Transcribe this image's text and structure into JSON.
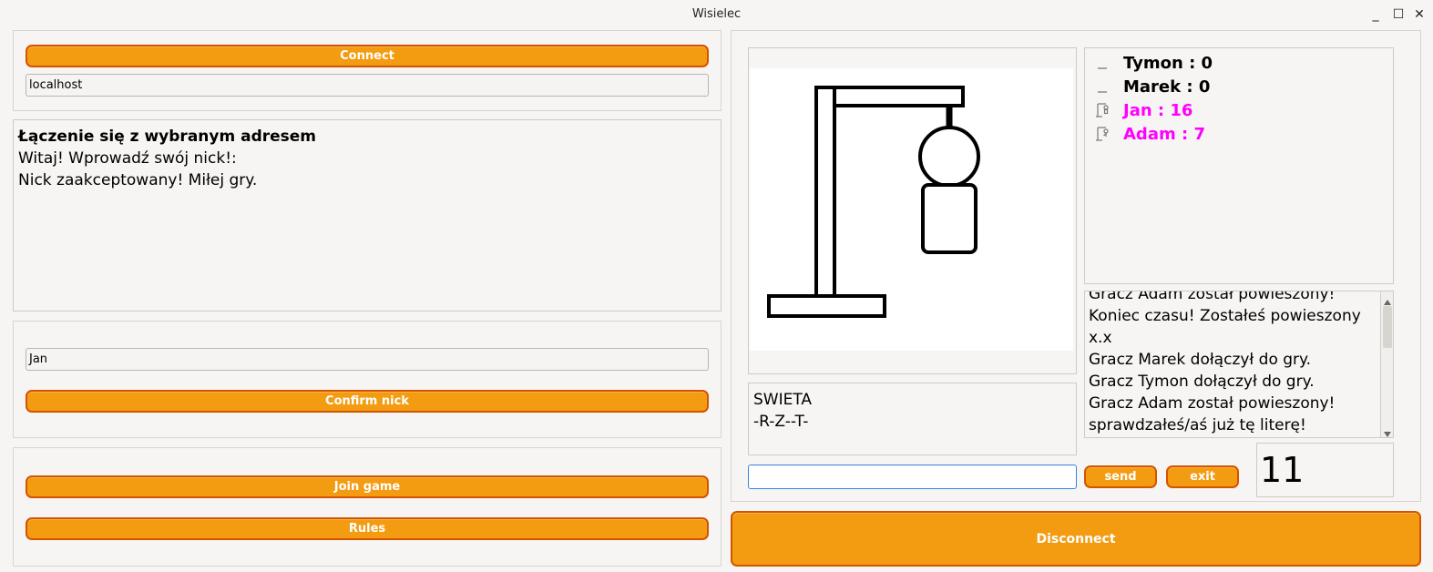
{
  "window": {
    "title": "Wisielec"
  },
  "window_controls": {
    "minimize": "_",
    "maximize": "☐",
    "close": "✕"
  },
  "connection": {
    "connect_label": "Connect",
    "host_value": "localhost"
  },
  "status_log": {
    "lines": [
      "Łączenie się z wybranym adresem",
      "Witaj! Wprowadź swój nick!:",
      "Nick zaakceptowany! Miłej gry."
    ]
  },
  "nick": {
    "value": "Jan",
    "confirm_label": "Confirm nick"
  },
  "game_buttons": {
    "join_label": "Join game",
    "rules_label": "Rules"
  },
  "disconnect_label": "Disconnect",
  "word": {
    "category": "SWIETA",
    "pattern": "-R-Z--T-"
  },
  "scores": [
    {
      "text": "Tymon : 0",
      "color": "#000000",
      "icon": "empty-gallows-icon"
    },
    {
      "text": "Marek : 0",
      "color": "#000000",
      "icon": "empty-gallows-icon"
    },
    {
      "text": "Jan : 16",
      "color": "#ff00ff",
      "icon": "gallows-icon"
    },
    {
      "text": "Adam : 7",
      "color": "#ff00ff",
      "icon": "gallows-icon"
    }
  ],
  "chat": {
    "lines": [
      "Gracz Adam został powieszony!",
      "Koniec czasu! Zostałeś powieszony",
      "x.x",
      "Gracz Marek dołączył do gry.",
      "Gracz Tymon dołączył do gry.",
      "Gracz Adam został powieszony!",
      "sprawdzałeś/aś już tę literę!"
    ]
  },
  "input": {
    "value": ""
  },
  "actions": {
    "send_label": "send",
    "exit_label": "exit"
  },
  "timer": {
    "value": "11"
  },
  "colors": {
    "accent": "#f39c12",
    "accent_border": "#d35400",
    "highlight": "#ff00ff"
  }
}
